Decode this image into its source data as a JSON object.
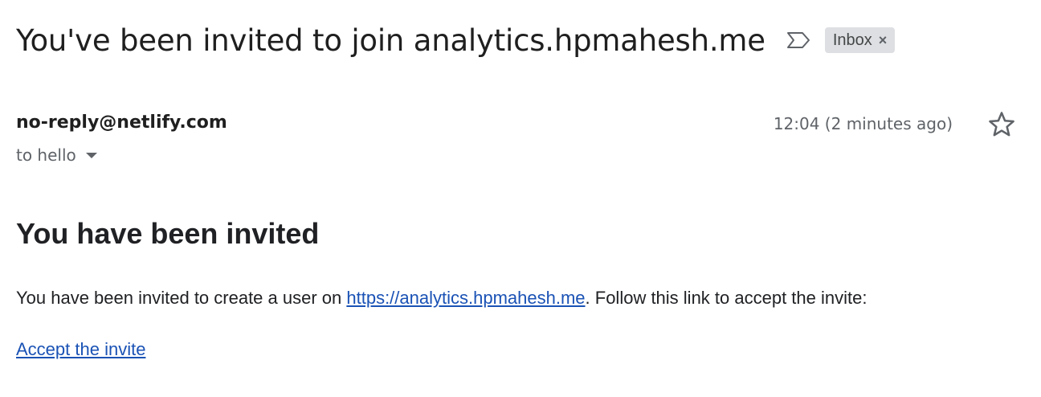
{
  "email": {
    "subject": "You've been invited to join analytics.hpmahesh.me",
    "label": "Inbox",
    "label_close": "×",
    "sender": "no-reply@netlify.com",
    "recipient_line": "to hello",
    "timestamp": "12:04 (2 minutes ago)",
    "icons": {
      "importance": "importance-marker-icon",
      "star": "star-icon",
      "recipient_details": "chevron-down-icon"
    }
  },
  "body": {
    "heading": "You have been invited",
    "text_before_link": "You have been invited to create a user on ",
    "site_link": "https://analytics.hpmahesh.me",
    "text_after_link": ". Follow this link to accept the invite:",
    "accept_link": "Accept the invite"
  },
  "colors": {
    "link": "#1a52b5",
    "chip_background": "#dddfe2",
    "secondary_text": "#5f6368"
  }
}
